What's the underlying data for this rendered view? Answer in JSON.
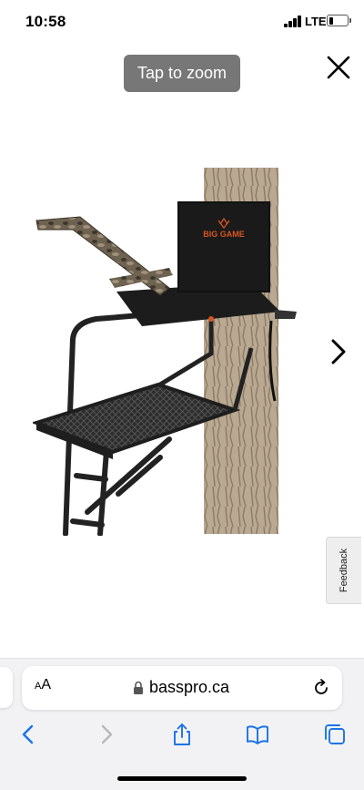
{
  "status_bar": {
    "time": "10:58",
    "network": "LTE",
    "battery_level": 0.3
  },
  "viewer": {
    "zoom_hint": "Tap to zoom",
    "close_icon": "close-icon",
    "next_icon": "chevron-right-icon",
    "product_image": {
      "description_icon": "ladder-treestand-image",
      "brand_mark": "BIG GAME"
    }
  },
  "feedback": {
    "label": "Feedback"
  },
  "browser": {
    "text_size_small": "A",
    "text_size_large": "A",
    "domain": "basspro.ca",
    "lock_icon": "lock-icon",
    "reload_icon": "reload-icon",
    "toolbar": {
      "back_icon": "chevron-left-icon",
      "forward_icon": "chevron-right-icon",
      "share_icon": "share-icon",
      "bookmarks_icon": "book-icon",
      "tabs_icon": "tabs-icon"
    }
  },
  "colors": {
    "toolbar_blue": "#1a73e8",
    "disabled_gray": "#b8b8bc",
    "hint_background": "#777777"
  }
}
